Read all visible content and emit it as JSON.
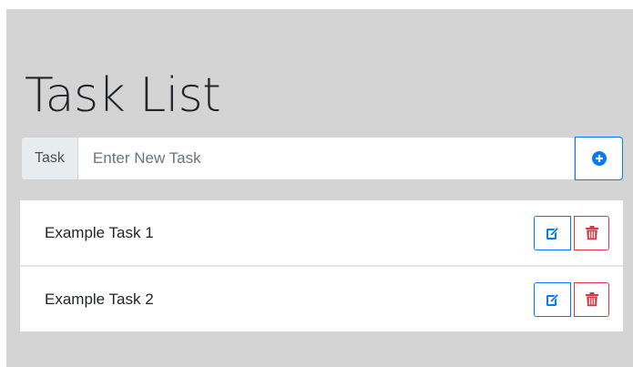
{
  "page": {
    "title": "Task List"
  },
  "new_task": {
    "label": "Task",
    "placeholder": "Enter New Task",
    "value": "",
    "add_icon": "plus-circle-icon"
  },
  "tasks": [
    {
      "text": "Example Task 1",
      "edit_icon": "edit-icon",
      "delete_icon": "trash-icon"
    },
    {
      "text": "Example Task 2",
      "edit_icon": "edit-icon",
      "delete_icon": "trash-icon"
    }
  ],
  "colors": {
    "background": "#d4d4d4",
    "primary": "#007bff",
    "danger": "#dc3545",
    "input_addon_bg": "#e9ecef"
  }
}
